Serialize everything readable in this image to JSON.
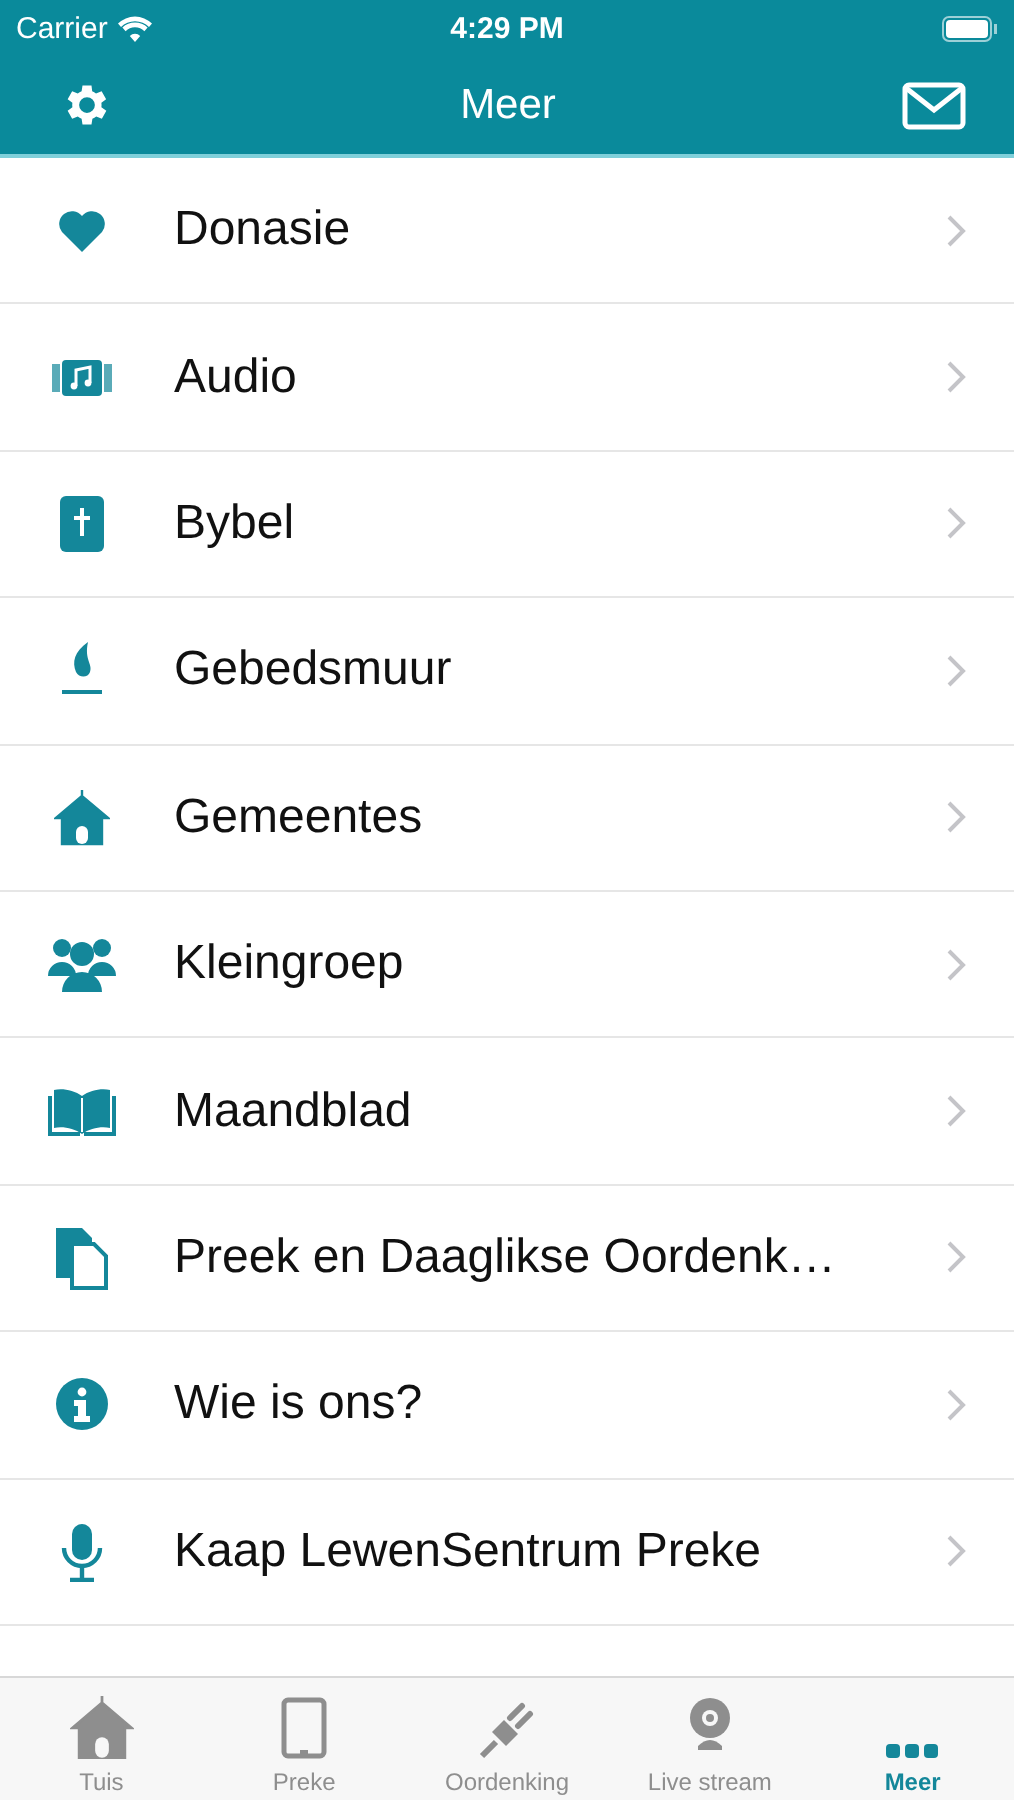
{
  "status_bar": {
    "carrier": "Carrier",
    "time": "4:29 PM"
  },
  "nav": {
    "title": "Meer"
  },
  "items": [
    {
      "label": "Donasie"
    },
    {
      "label": "Audio"
    },
    {
      "label": "Bybel"
    },
    {
      "label": "Gebedsmuur"
    },
    {
      "label": "Gemeentes"
    },
    {
      "label": "Kleingroep"
    },
    {
      "label": "Maandblad"
    },
    {
      "label": "Preek en Daaglikse Oordenk…"
    },
    {
      "label": "Wie is ons?"
    },
    {
      "label": "Kaap LewenSentrum Preke"
    }
  ],
  "tabs": [
    {
      "label": "Tuis",
      "selected": false
    },
    {
      "label": "Preke",
      "selected": false
    },
    {
      "label": "Oordenking",
      "selected": false
    },
    {
      "label": "Live stream",
      "selected": false
    },
    {
      "label": "Meer",
      "selected": true
    }
  ]
}
